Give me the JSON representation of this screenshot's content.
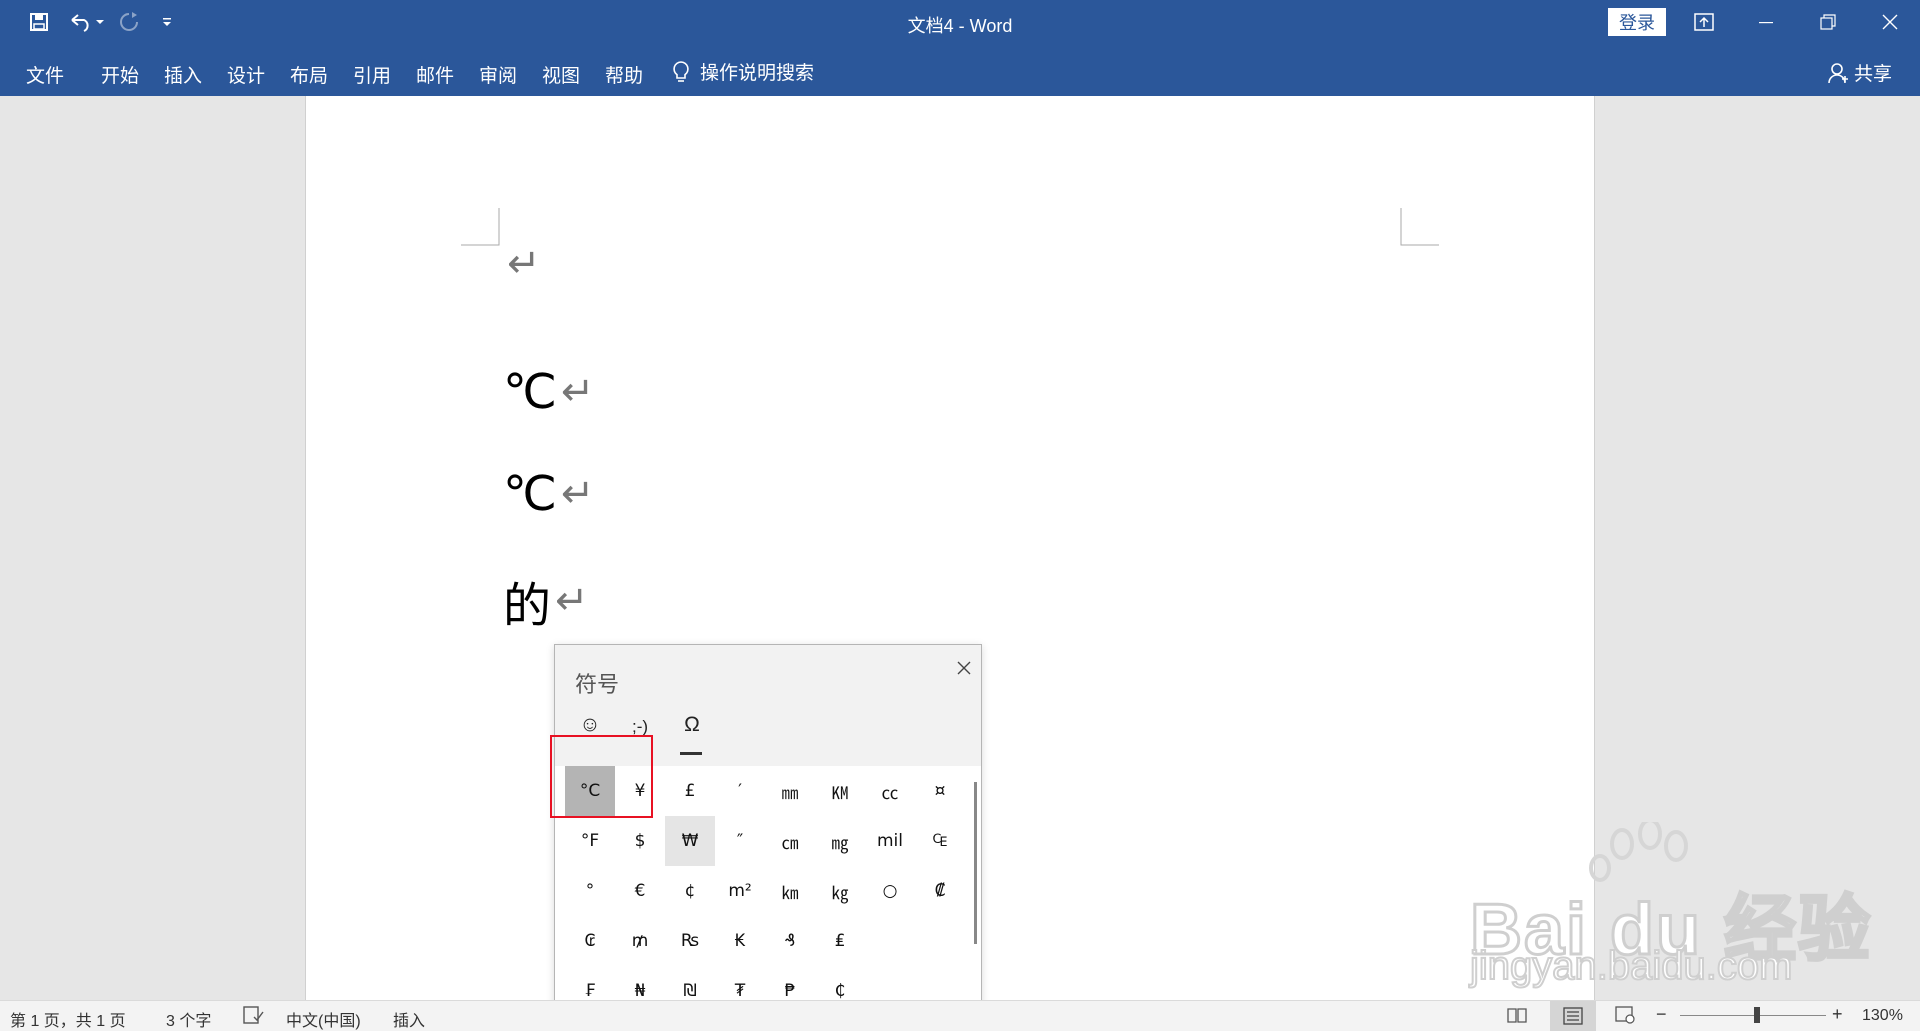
{
  "window": {
    "title": "文档4  -  Word",
    "login_label": "登录",
    "accent": "#2b579a"
  },
  "quick_access": [
    "save-icon",
    "undo-icon",
    "redo-icon",
    "customize-icon"
  ],
  "ribbon": {
    "tabs": [
      "文件",
      "开始",
      "插入",
      "设计",
      "布局",
      "引用",
      "邮件",
      "审阅",
      "视图",
      "帮助"
    ],
    "tell_me": "操作说明搜索",
    "share": "共享"
  },
  "document": {
    "paragraphs": [
      "",
      "℃",
      "℃",
      "的"
    ],
    "paragraph_mark": "↵"
  },
  "symbol_panel": {
    "title": "符号",
    "category_tabs": [
      "☺",
      ";-)",
      "Ω"
    ],
    "active_category": 2,
    "selected_symbol": "°C",
    "symbols": [
      [
        "°C",
        "¥",
        "£",
        "′",
        "㎜",
        "㏎",
        "㏄",
        "¤"
      ],
      [
        "°F",
        "$",
        "₩",
        "″",
        "㎝",
        "㎎",
        "mil",
        "₠"
      ],
      [
        "°",
        "€",
        "¢",
        "m²",
        "㎞",
        "㎏",
        "○",
        "₡"
      ],
      [
        "₢",
        "₥",
        "₨",
        "₭",
        "₰",
        "₤",
        "",
        ""
      ],
      [
        "₣",
        "₦",
        "₪",
        "₮",
        "₱",
        "₵",
        "",
        ""
      ]
    ]
  },
  "statusbar": {
    "page": "第 1 页，共 1 页",
    "words": "3 个字",
    "language": "中文(中国)",
    "mode": "插入",
    "zoom_percent": "130%"
  },
  "watermark": {
    "brand": "Bai du 经验",
    "url": "jingyan.baidu.com"
  }
}
